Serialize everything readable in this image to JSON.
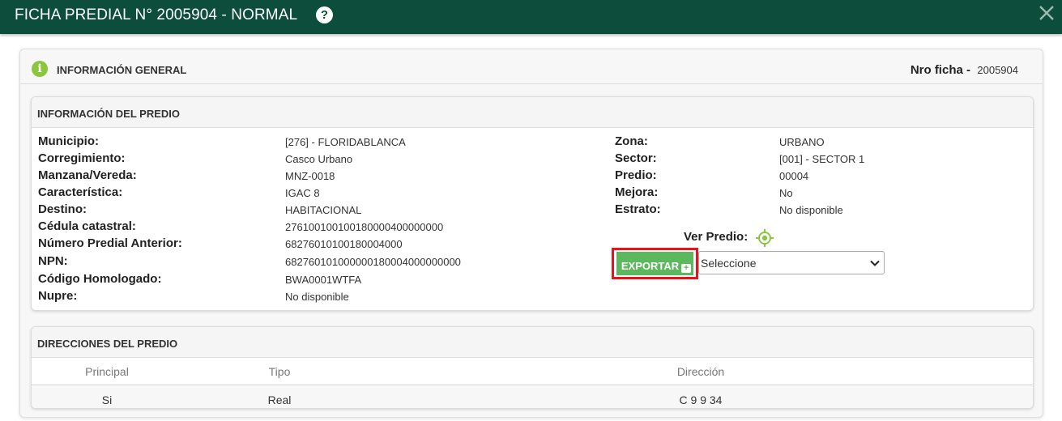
{
  "window": {
    "title": "FICHA PREDIAL N° 2005904 - NORMAL",
    "help_glyph": "?"
  },
  "general": {
    "title": "INFORMACIÓN GENERAL",
    "nro_label": "Nro ficha -",
    "nro_value": "2005904"
  },
  "predio": {
    "title": "INFORMACIÓN DEL PREDIO",
    "left_fields": [
      {
        "label": "Municipio:",
        "value": "[276] - FLORIDABLANCA"
      },
      {
        "label": "Corregimiento:",
        "value": "Casco Urbano"
      },
      {
        "label": "Manzana/Vereda:",
        "value": "MNZ-0018"
      },
      {
        "label": "Característica:",
        "value": "IGAC 8"
      },
      {
        "label": "Destino:",
        "value": "HABITACIONAL"
      },
      {
        "label": "Cédula catastral:",
        "value": "276100100100180000400000000"
      },
      {
        "label": "Número Predial Anterior:",
        "value": "68276010100180004000"
      },
      {
        "label": "NPN:",
        "value": "682760101000000180004000000000"
      },
      {
        "label": "Código Homologado:",
        "value": "BWA0001WTFA"
      },
      {
        "label": "Nupre:",
        "value": "No disponible"
      }
    ],
    "right_fields": [
      {
        "label": "Zona:",
        "value": "URBANO"
      },
      {
        "label": "Sector:",
        "value": "[001] - SECTOR 1"
      },
      {
        "label": "Predio:",
        "value": "00004"
      },
      {
        "label": "Mejora:",
        "value": "No"
      },
      {
        "label": "Estrato:",
        "value": "No disponible"
      }
    ],
    "ver_predio_label": "Ver Predio:",
    "export_label": "EXPORTAR",
    "select_value": "Seleccione"
  },
  "direcciones": {
    "title": "DIRECCIONES DEL PREDIO",
    "columns": [
      "Principal",
      "Tipo",
      "Dirección"
    ],
    "rows": [
      [
        "Si",
        "Real",
        "C 9 9 34"
      ]
    ]
  },
  "colors": {
    "titlebar": "#0c4d3b",
    "info_icon": "#8cc63f",
    "export_button": "#5cb85c",
    "highlight_border": "#e3141b"
  }
}
